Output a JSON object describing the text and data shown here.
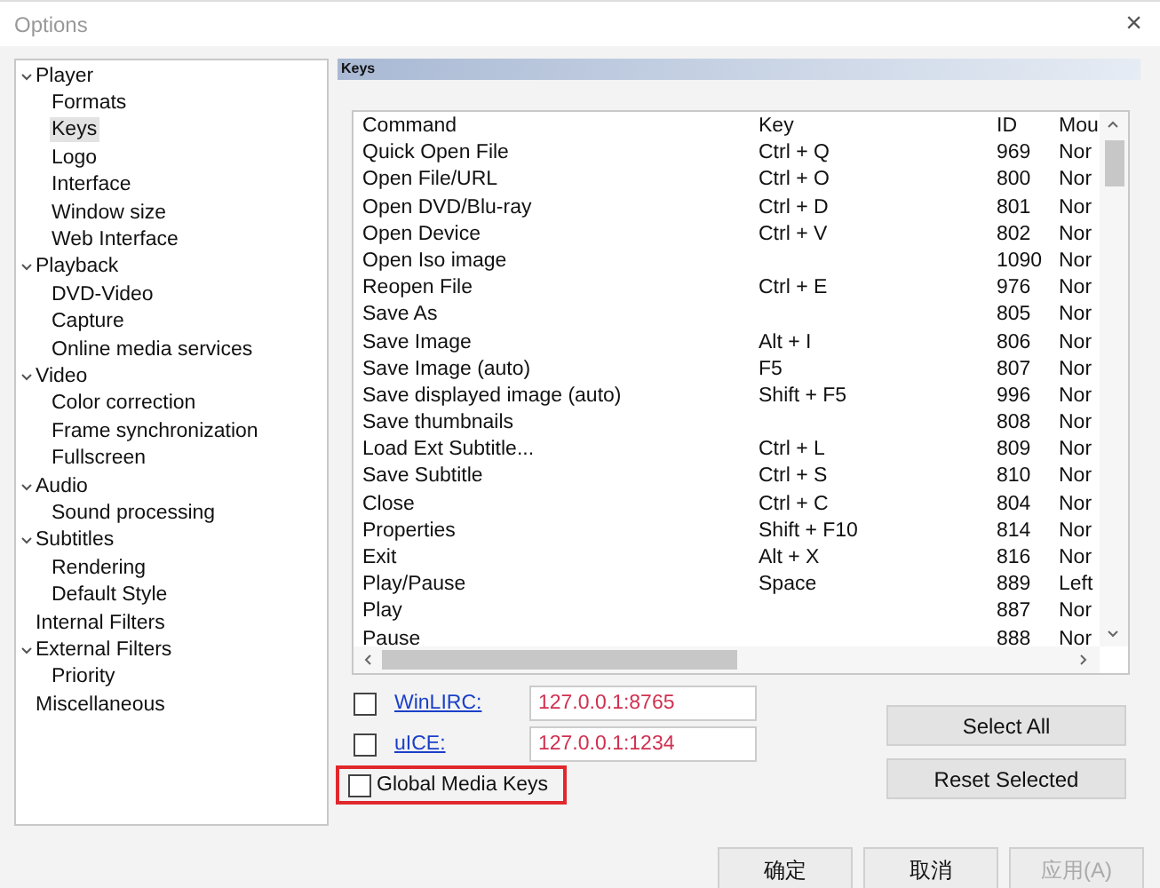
{
  "window": {
    "title": "Options",
    "close": "×"
  },
  "tree": [
    {
      "label": "Player",
      "expanded": true,
      "selected": false,
      "children": [
        {
          "label": "Formats",
          "selected": false
        },
        {
          "label": "Keys",
          "selected": true
        },
        {
          "label": "Logo",
          "selected": false
        },
        {
          "label": "Interface",
          "selected": false
        },
        {
          "label": "Window size",
          "selected": false
        },
        {
          "label": "Web Interface",
          "selected": false
        }
      ]
    },
    {
      "label": "Playback",
      "expanded": true,
      "selected": false,
      "children": [
        {
          "label": "DVD-Video",
          "selected": false
        },
        {
          "label": "Capture",
          "selected": false
        },
        {
          "label": "Online media services",
          "selected": false
        }
      ]
    },
    {
      "label": "Video",
      "expanded": true,
      "selected": false,
      "children": [
        {
          "label": "Color correction",
          "selected": false
        },
        {
          "label": "Frame synchronization",
          "selected": false
        },
        {
          "label": "Fullscreen",
          "selected": false
        }
      ]
    },
    {
      "label": "Audio",
      "expanded": true,
      "selected": false,
      "children": [
        {
          "label": "Sound processing",
          "selected": false
        }
      ]
    },
    {
      "label": "Subtitles",
      "expanded": true,
      "selected": false,
      "children": [
        {
          "label": "Rendering",
          "selected": false
        },
        {
          "label": "Default Style",
          "selected": false
        }
      ]
    },
    {
      "label": "Internal Filters",
      "selected": false
    },
    {
      "label": "External Filters",
      "expanded": true,
      "selected": false,
      "children": [
        {
          "label": "Priority",
          "selected": false
        }
      ]
    },
    {
      "label": "Miscellaneous",
      "selected": false
    }
  ],
  "page_header": "Keys",
  "table": {
    "columns": [
      "Command",
      "Key",
      "ID",
      "Mou"
    ],
    "rows": [
      [
        "Quick Open File",
        "Ctrl + Q",
        "969",
        "Nor"
      ],
      [
        "Open File/URL",
        "Ctrl + O",
        "800",
        "Nor"
      ],
      [
        "Open DVD/Blu-ray",
        "Ctrl + D",
        "801",
        "Nor"
      ],
      [
        "Open Device",
        "Ctrl + V",
        "802",
        "Nor"
      ],
      [
        "Open Iso image",
        "",
        "1090",
        "Nor"
      ],
      [
        "Reopen File",
        "Ctrl + E",
        "976",
        "Nor"
      ],
      [
        "Save As",
        "",
        "805",
        "Nor"
      ],
      [
        "Save Image",
        "Alt + I",
        "806",
        "Nor"
      ],
      [
        "Save Image (auto)",
        "F5",
        "807",
        "Nor"
      ],
      [
        "Save displayed image (auto)",
        "Shift + F5",
        "996",
        "Nor"
      ],
      [
        "Save thumbnails",
        "",
        "808",
        "Nor"
      ],
      [
        "Load Ext Subtitle...",
        "Ctrl + L",
        "809",
        "Nor"
      ],
      [
        "Save Subtitle",
        "Ctrl + S",
        "810",
        "Nor"
      ],
      [
        "Close",
        "Ctrl + C",
        "804",
        "Nor"
      ],
      [
        "Properties",
        "Shift + F10",
        "814",
        "Nor"
      ],
      [
        "Exit",
        "Alt + X",
        "816",
        "Nor"
      ],
      [
        "Play/Pause",
        "Space",
        "889",
        "Left"
      ],
      [
        "Play",
        "",
        "887",
        "Nor"
      ],
      [
        "Pause",
        "",
        "888",
        "Nor"
      ]
    ]
  },
  "options": [
    {
      "kind": "link",
      "label": "WinLIRC:",
      "checked": false,
      "value": "127.0.0.1:8765"
    },
    {
      "kind": "link",
      "label": "uICE:",
      "checked": false,
      "value": "127.0.0.1:1234"
    },
    {
      "kind": "plain",
      "label": "Global Media Keys",
      "checked": false,
      "highlighted": true
    }
  ],
  "side_buttons": [
    {
      "label": "Select All"
    },
    {
      "label": "Reset Selected"
    }
  ],
  "footer_buttons": [
    {
      "label": "确定",
      "disabled": false
    },
    {
      "label": "取消",
      "disabled": false
    },
    {
      "label": "应用(A)",
      "disabled": true
    }
  ]
}
